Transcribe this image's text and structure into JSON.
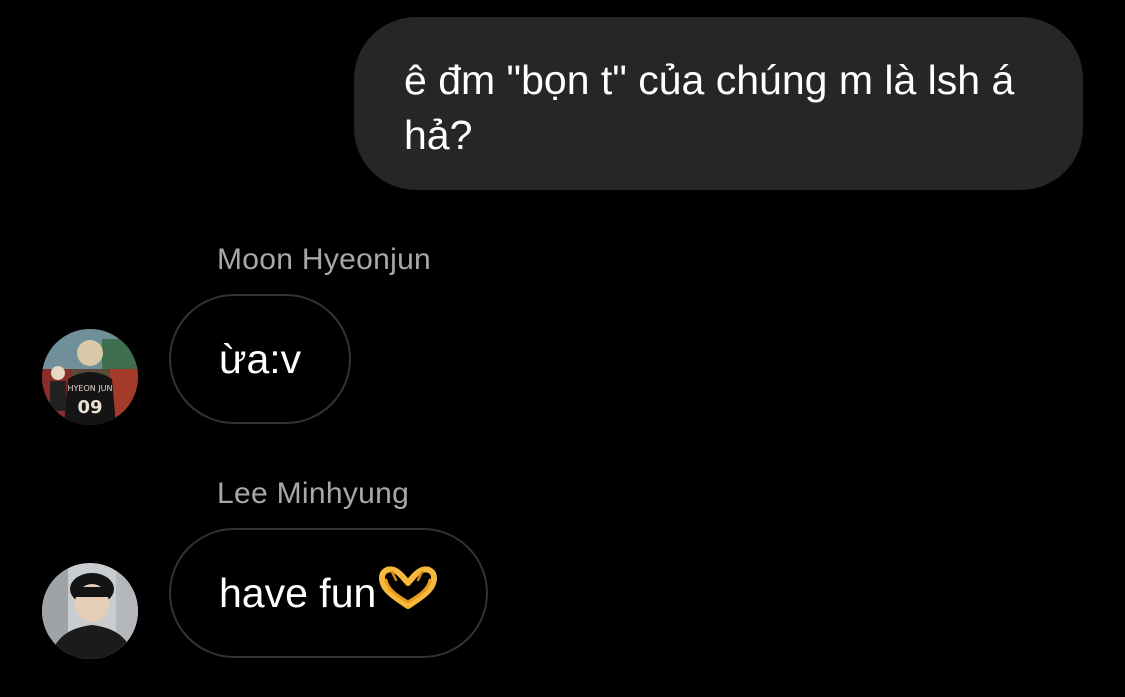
{
  "conversation": {
    "outgoing": [
      {
        "text": "ê đm \"bọn t\" của chúng m là lsh á hả?"
      }
    ],
    "incoming": [
      {
        "sender": "Moon Hyeonjun",
        "text": "ừa:v",
        "avatar_icon": "user-avatar-photo"
      },
      {
        "sender": "Lee Minhyung",
        "text": "have fun",
        "emoji": "heart-hands-emoji",
        "avatar_icon": "user-avatar-photo"
      }
    ]
  },
  "colors": {
    "background": "#000000",
    "outgoing_bubble": "#262626",
    "incoming_bubble_border": "#333333",
    "sender_name": "#a8a8a8",
    "text": "#ffffff",
    "emoji": "#f6b93b"
  }
}
